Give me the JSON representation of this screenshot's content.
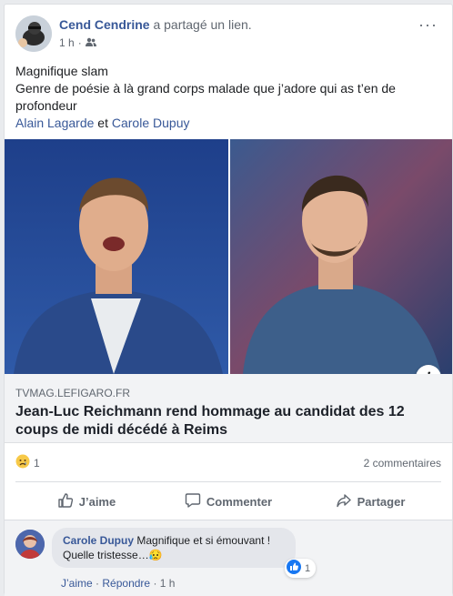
{
  "post": {
    "author": "Cend Cendrine",
    "action": "a partagé un lien.",
    "time": "1 h",
    "privacy_icon": "friends-icon",
    "more_icon": "more-options-icon",
    "text_line1": "Magnifique slam",
    "text_line2": "Genre de poésie à là grand corps malade que j’adore qui as t’en de profondeur",
    "tag1": "Alain Lagarde",
    "tag_sep": " et ",
    "tag2": "Carole Dupuy"
  },
  "link": {
    "domain": "TVMAG.LEFIGARO.FR",
    "headline": "Jean-Luc Reichmann rend hommage au candidat des 12 coups de midi décédé à Reims",
    "info_icon": "i"
  },
  "stats": {
    "reaction_icon": "sad-reaction-icon",
    "reaction_count": "1",
    "comments": "2 commentaires"
  },
  "actions": {
    "like": "J’aime",
    "comment": "Commenter",
    "share": "Partager"
  },
  "comment": {
    "author": "Carole Dupuy",
    "text": "Magnifique et si émouvant ! Quelle tristesse…",
    "emoji": "😥",
    "like_count": "1",
    "like": "J’aime",
    "reply": "Répondre",
    "time": "1 h"
  },
  "colors": {
    "link": "#385898",
    "background": "#e9ebee",
    "muted": "#606770"
  }
}
